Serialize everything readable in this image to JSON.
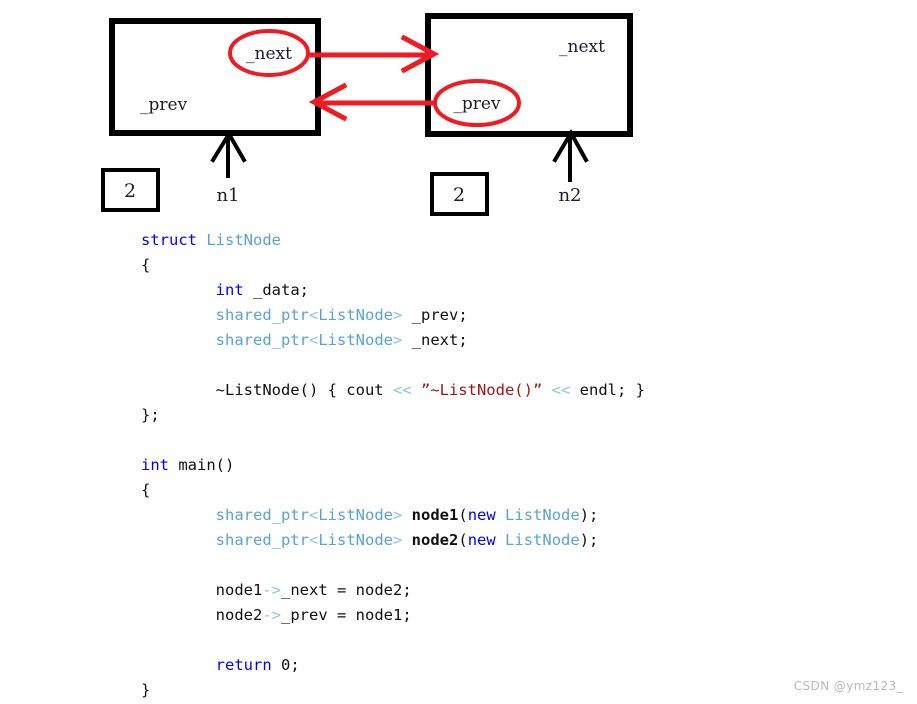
{
  "diagram": {
    "nodes": [
      {
        "id": "n1",
        "inner_label_bottom": "_prev",
        "circled_label": "_next",
        "pointer_name": "n1",
        "ref_count": "2"
      },
      {
        "id": "n2",
        "inner_label_top": "_next",
        "circled_label": "_prev",
        "pointer_name": "n2",
        "ref_count": "2"
      }
    ],
    "arrows": [
      {
        "name": "next-arrow",
        "from": "n1._next",
        "to": "n2",
        "color": "#ee1b24"
      },
      {
        "name": "prev-arrow",
        "from": "n2._prev",
        "to": "n1",
        "color": "#ee1b24"
      }
    ],
    "colors": {
      "box_stroke": "#000000",
      "highlight": "#ee1b24",
      "pointer_arrow": "#000000",
      "text": "#1c1c2e"
    }
  },
  "code": {
    "language": "cpp",
    "lines": [
      [
        {
          "t": "struct ",
          "c": "kw"
        },
        {
          "t": "ListNode",
          "c": "type"
        }
      ],
      [
        {
          "t": "{",
          "c": "plain"
        }
      ],
      [
        {
          "t": "        ",
          "c": "plain"
        },
        {
          "t": "int",
          "c": "kw"
        },
        {
          "t": " _data;",
          "c": "plain"
        }
      ],
      [
        {
          "t": "        ",
          "c": "plain"
        },
        {
          "t": "shared_ptr",
          "c": "type"
        },
        {
          "t": "<",
          "c": "op"
        },
        {
          "t": "ListNode",
          "c": "type"
        },
        {
          "t": ">",
          "c": "op"
        },
        {
          "t": " _prev;",
          "c": "plain"
        }
      ],
      [
        {
          "t": "        ",
          "c": "plain"
        },
        {
          "t": "shared_ptr",
          "c": "type"
        },
        {
          "t": "<",
          "c": "op"
        },
        {
          "t": "ListNode",
          "c": "type"
        },
        {
          "t": ">",
          "c": "op"
        },
        {
          "t": " _next;",
          "c": "plain"
        }
      ],
      [
        {
          "t": "",
          "c": "plain"
        }
      ],
      [
        {
          "t": "        ~ListNode() { cout ",
          "c": "plain"
        },
        {
          "t": "<<",
          "c": "op"
        },
        {
          "t": " ",
          "c": "plain"
        },
        {
          "t": "”~ListNode()”",
          "c": "str"
        },
        {
          "t": " ",
          "c": "plain"
        },
        {
          "t": "<<",
          "c": "op"
        },
        {
          "t": " endl; }",
          "c": "plain"
        }
      ],
      [
        {
          "t": "};",
          "c": "plain"
        }
      ],
      [
        {
          "t": "",
          "c": "plain"
        }
      ],
      [
        {
          "t": "int",
          "c": "kw"
        },
        {
          "t": " main()",
          "c": "plain"
        }
      ],
      [
        {
          "t": "{",
          "c": "plain"
        }
      ],
      [
        {
          "t": "        ",
          "c": "plain"
        },
        {
          "t": "shared_ptr",
          "c": "type"
        },
        {
          "t": "<",
          "c": "op"
        },
        {
          "t": "ListNode",
          "c": "type"
        },
        {
          "t": ">",
          "c": "op"
        },
        {
          "t": " ",
          "c": "plain"
        },
        {
          "t": "node1",
          "c": "ident"
        },
        {
          "t": "(",
          "c": "plain"
        },
        {
          "t": "new",
          "c": "kw"
        },
        {
          "t": " ",
          "c": "plain"
        },
        {
          "t": "ListNode",
          "c": "type"
        },
        {
          "t": ");",
          "c": "plain"
        }
      ],
      [
        {
          "t": "        ",
          "c": "plain"
        },
        {
          "t": "shared_ptr",
          "c": "type"
        },
        {
          "t": "<",
          "c": "op"
        },
        {
          "t": "ListNode",
          "c": "type"
        },
        {
          "t": ">",
          "c": "op"
        },
        {
          "t": " ",
          "c": "plain"
        },
        {
          "t": "node2",
          "c": "ident"
        },
        {
          "t": "(",
          "c": "plain"
        },
        {
          "t": "new",
          "c": "kw"
        },
        {
          "t": " ",
          "c": "plain"
        },
        {
          "t": "ListNode",
          "c": "type"
        },
        {
          "t": ");",
          "c": "plain"
        }
      ],
      [
        {
          "t": "",
          "c": "plain"
        }
      ],
      [
        {
          "t": "        node1",
          "c": "plain"
        },
        {
          "t": "->",
          "c": "op"
        },
        {
          "t": "_next = node2;",
          "c": "plain"
        }
      ],
      [
        {
          "t": "        node2",
          "c": "plain"
        },
        {
          "t": "->",
          "c": "op"
        },
        {
          "t": "_prev = node1;",
          "c": "plain"
        }
      ],
      [
        {
          "t": "",
          "c": "plain"
        }
      ],
      [
        {
          "t": "        ",
          "c": "plain"
        },
        {
          "t": "return",
          "c": "kw"
        },
        {
          "t": " 0;",
          "c": "plain"
        }
      ],
      [
        {
          "t": "}",
          "c": "plain"
        }
      ]
    ]
  },
  "watermark": {
    "text": "CSDN @ymz123_"
  }
}
